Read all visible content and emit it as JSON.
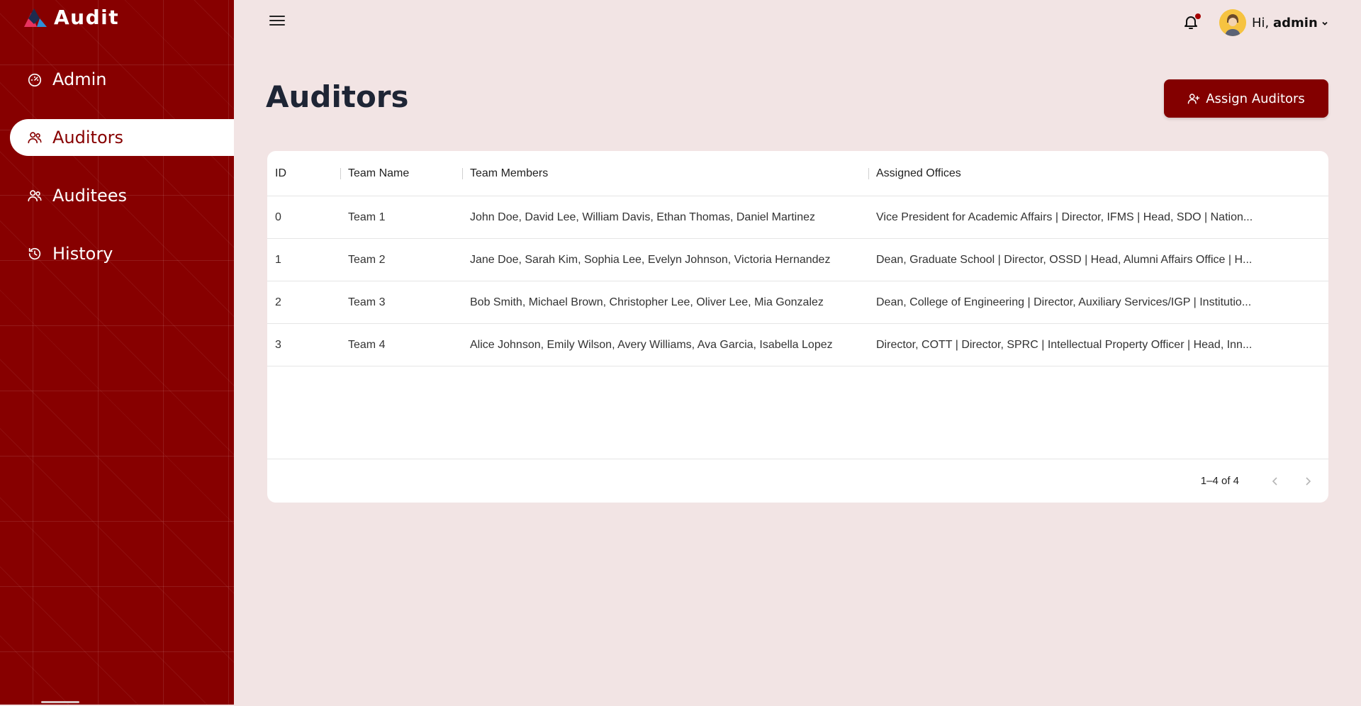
{
  "app": {
    "brand_name": "Audit",
    "brand_colors": [
      "#e8335f",
      "#1d2b4f",
      "#2e8fd8"
    ]
  },
  "sidebar": {
    "items": [
      {
        "label": "Admin",
        "icon": "dashboard-gauge-icon",
        "active": false
      },
      {
        "label": "Auditors",
        "icon": "users-icon",
        "active": true
      },
      {
        "label": "Auditees",
        "icon": "users-icon",
        "active": false
      },
      {
        "label": "History",
        "icon": "history-clock-icon",
        "active": false
      }
    ]
  },
  "topbar": {
    "menu_icon": "hamburger-menu-icon",
    "notification_icon": "bell-icon",
    "greeting": "Hi,",
    "username": "admin"
  },
  "page": {
    "title": "Auditors",
    "assign_button_label": "Assign Auditors"
  },
  "table": {
    "columns": [
      "ID",
      "Team Name",
      "Team Members",
      "Assigned Offices"
    ],
    "rows": [
      {
        "id": "0",
        "team": "Team 1",
        "members": "John Doe, David Lee, William Davis, Ethan Thomas, Daniel Martinez",
        "offices": "Vice President for Academic Affairs | Director, IFMS | Head, SDO | Nation..."
      },
      {
        "id": "1",
        "team": "Team 2",
        "members": "Jane Doe, Sarah Kim, Sophia Lee, Evelyn Johnson, Victoria Hernandez",
        "offices": "Dean, Graduate School | Director, OSSD | Head, Alumni Affairs Office | H..."
      },
      {
        "id": "2",
        "team": "Team 3",
        "members": "Bob Smith, Michael Brown, Christopher Lee, Oliver Lee, Mia Gonzalez",
        "offices": "Dean, College of Engineering | Director, Auxiliary Services/IGP | Institutio..."
      },
      {
        "id": "3",
        "team": "Team 4",
        "members": "Alice Johnson, Emily Wilson, Avery Williams, Ava Garcia, Isabella Lopez",
        "offices": "Director, COTT | Director, SPRC | Intellectual Property Officer | Head, Inn..."
      }
    ],
    "pagination": "1–4 of 4"
  },
  "colors": {
    "sidebar_bg": "#870000",
    "page_bg": "#f2e4e4",
    "accent": "#830000"
  }
}
